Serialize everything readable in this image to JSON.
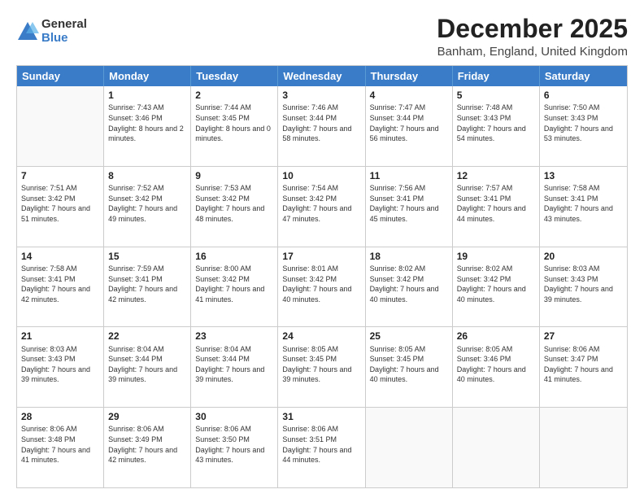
{
  "logo": {
    "general": "General",
    "blue": "Blue"
  },
  "title": "December 2025",
  "location": "Banham, England, United Kingdom",
  "header_days": [
    "Sunday",
    "Monday",
    "Tuesday",
    "Wednesday",
    "Thursday",
    "Friday",
    "Saturday"
  ],
  "weeks": [
    [
      {
        "day": "",
        "empty": true
      },
      {
        "day": "1",
        "sunrise": "Sunrise: 7:43 AM",
        "sunset": "Sunset: 3:46 PM",
        "daylight": "Daylight: 8 hours and 2 minutes."
      },
      {
        "day": "2",
        "sunrise": "Sunrise: 7:44 AM",
        "sunset": "Sunset: 3:45 PM",
        "daylight": "Daylight: 8 hours and 0 minutes."
      },
      {
        "day": "3",
        "sunrise": "Sunrise: 7:46 AM",
        "sunset": "Sunset: 3:44 PM",
        "daylight": "Daylight: 7 hours and 58 minutes."
      },
      {
        "day": "4",
        "sunrise": "Sunrise: 7:47 AM",
        "sunset": "Sunset: 3:44 PM",
        "daylight": "Daylight: 7 hours and 56 minutes."
      },
      {
        "day": "5",
        "sunrise": "Sunrise: 7:48 AM",
        "sunset": "Sunset: 3:43 PM",
        "daylight": "Daylight: 7 hours and 54 minutes."
      },
      {
        "day": "6",
        "sunrise": "Sunrise: 7:50 AM",
        "sunset": "Sunset: 3:43 PM",
        "daylight": "Daylight: 7 hours and 53 minutes."
      }
    ],
    [
      {
        "day": "7",
        "sunrise": "Sunrise: 7:51 AM",
        "sunset": "Sunset: 3:42 PM",
        "daylight": "Daylight: 7 hours and 51 minutes."
      },
      {
        "day": "8",
        "sunrise": "Sunrise: 7:52 AM",
        "sunset": "Sunset: 3:42 PM",
        "daylight": "Daylight: 7 hours and 49 minutes."
      },
      {
        "day": "9",
        "sunrise": "Sunrise: 7:53 AM",
        "sunset": "Sunset: 3:42 PM",
        "daylight": "Daylight: 7 hours and 48 minutes."
      },
      {
        "day": "10",
        "sunrise": "Sunrise: 7:54 AM",
        "sunset": "Sunset: 3:42 PM",
        "daylight": "Daylight: 7 hours and 47 minutes."
      },
      {
        "day": "11",
        "sunrise": "Sunrise: 7:56 AM",
        "sunset": "Sunset: 3:41 PM",
        "daylight": "Daylight: 7 hours and 45 minutes."
      },
      {
        "day": "12",
        "sunrise": "Sunrise: 7:57 AM",
        "sunset": "Sunset: 3:41 PM",
        "daylight": "Daylight: 7 hours and 44 minutes."
      },
      {
        "day": "13",
        "sunrise": "Sunrise: 7:58 AM",
        "sunset": "Sunset: 3:41 PM",
        "daylight": "Daylight: 7 hours and 43 minutes."
      }
    ],
    [
      {
        "day": "14",
        "sunrise": "Sunrise: 7:58 AM",
        "sunset": "Sunset: 3:41 PM",
        "daylight": "Daylight: 7 hours and 42 minutes."
      },
      {
        "day": "15",
        "sunrise": "Sunrise: 7:59 AM",
        "sunset": "Sunset: 3:41 PM",
        "daylight": "Daylight: 7 hours and 42 minutes."
      },
      {
        "day": "16",
        "sunrise": "Sunrise: 8:00 AM",
        "sunset": "Sunset: 3:42 PM",
        "daylight": "Daylight: 7 hours and 41 minutes."
      },
      {
        "day": "17",
        "sunrise": "Sunrise: 8:01 AM",
        "sunset": "Sunset: 3:42 PM",
        "daylight": "Daylight: 7 hours and 40 minutes."
      },
      {
        "day": "18",
        "sunrise": "Sunrise: 8:02 AM",
        "sunset": "Sunset: 3:42 PM",
        "daylight": "Daylight: 7 hours and 40 minutes."
      },
      {
        "day": "19",
        "sunrise": "Sunrise: 8:02 AM",
        "sunset": "Sunset: 3:42 PM",
        "daylight": "Daylight: 7 hours and 40 minutes."
      },
      {
        "day": "20",
        "sunrise": "Sunrise: 8:03 AM",
        "sunset": "Sunset: 3:43 PM",
        "daylight": "Daylight: 7 hours and 39 minutes."
      }
    ],
    [
      {
        "day": "21",
        "sunrise": "Sunrise: 8:03 AM",
        "sunset": "Sunset: 3:43 PM",
        "daylight": "Daylight: 7 hours and 39 minutes."
      },
      {
        "day": "22",
        "sunrise": "Sunrise: 8:04 AM",
        "sunset": "Sunset: 3:44 PM",
        "daylight": "Daylight: 7 hours and 39 minutes."
      },
      {
        "day": "23",
        "sunrise": "Sunrise: 8:04 AM",
        "sunset": "Sunset: 3:44 PM",
        "daylight": "Daylight: 7 hours and 39 minutes."
      },
      {
        "day": "24",
        "sunrise": "Sunrise: 8:05 AM",
        "sunset": "Sunset: 3:45 PM",
        "daylight": "Daylight: 7 hours and 39 minutes."
      },
      {
        "day": "25",
        "sunrise": "Sunrise: 8:05 AM",
        "sunset": "Sunset: 3:45 PM",
        "daylight": "Daylight: 7 hours and 40 minutes."
      },
      {
        "day": "26",
        "sunrise": "Sunrise: 8:05 AM",
        "sunset": "Sunset: 3:46 PM",
        "daylight": "Daylight: 7 hours and 40 minutes."
      },
      {
        "day": "27",
        "sunrise": "Sunrise: 8:06 AM",
        "sunset": "Sunset: 3:47 PM",
        "daylight": "Daylight: 7 hours and 41 minutes."
      }
    ],
    [
      {
        "day": "28",
        "sunrise": "Sunrise: 8:06 AM",
        "sunset": "Sunset: 3:48 PM",
        "daylight": "Daylight: 7 hours and 41 minutes."
      },
      {
        "day": "29",
        "sunrise": "Sunrise: 8:06 AM",
        "sunset": "Sunset: 3:49 PM",
        "daylight": "Daylight: 7 hours and 42 minutes."
      },
      {
        "day": "30",
        "sunrise": "Sunrise: 8:06 AM",
        "sunset": "Sunset: 3:50 PM",
        "daylight": "Daylight: 7 hours and 43 minutes."
      },
      {
        "day": "31",
        "sunrise": "Sunrise: 8:06 AM",
        "sunset": "Sunset: 3:51 PM",
        "daylight": "Daylight: 7 hours and 44 minutes."
      },
      {
        "day": "",
        "empty": true
      },
      {
        "day": "",
        "empty": true
      },
      {
        "day": "",
        "empty": true
      }
    ]
  ]
}
